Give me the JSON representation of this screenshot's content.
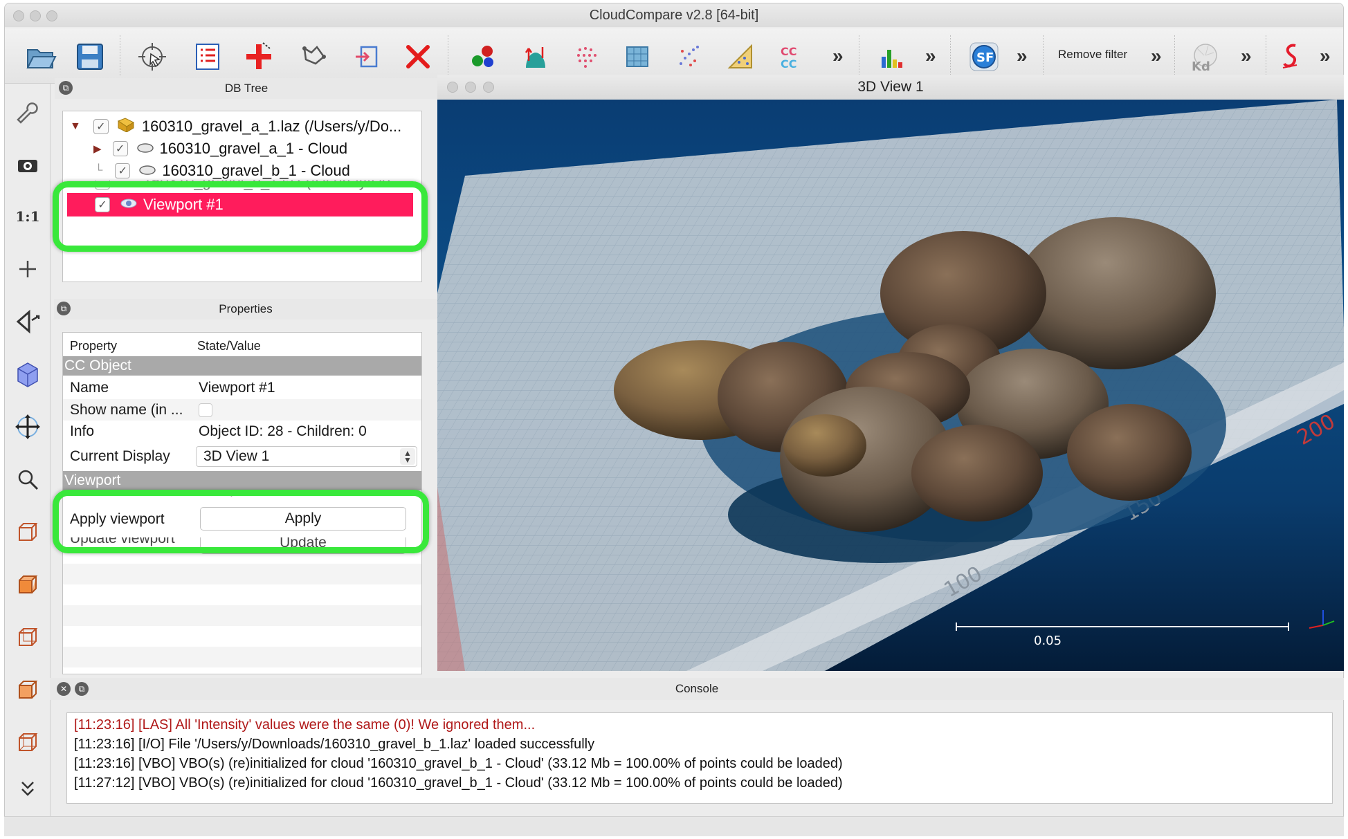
{
  "window": {
    "title": "CloudCompare v2.8 [64-bit]"
  },
  "toolbar": {
    "icons": [
      "open-folder-icon",
      "save-disk-icon",
      "cursor-select-icon",
      "list-icon",
      "add-point-icon",
      "segment-icon",
      "export-icon",
      "delete-x-icon",
      "color-icon",
      "normals-icon",
      "sample-icon",
      "mesh-icon",
      "noise-icon",
      "clean-icon",
      "cc-icon",
      "histogram-icon",
      "sf-icon",
      "kd-icon",
      "script-icon"
    ],
    "remove_filter_label": "Remove filter",
    "overflow_label": "»"
  },
  "left_tools": {
    "icons": [
      "wrench-icon",
      "camera-icon",
      "one-to-one-icon",
      "plus-icon",
      "perspective-icon",
      "cube-icon",
      "move-icon",
      "zoom-icon",
      "front-view-icon",
      "top-view-icon",
      "side-view-icon",
      "back-view-icon",
      "iso-view-icon",
      "expand-icon"
    ],
    "one_to_one_label": "1:1"
  },
  "db_tree": {
    "title": "DB Tree",
    "items": [
      {
        "label": "160310_gravel_a_1.laz (/Users/y/Do..."
      },
      {
        "label": "160310_gravel_a_1 - Cloud"
      },
      {
        "label": "160310_gravel_b_1 - Cloud"
      },
      {
        "label": "160310_gravel_b_1.laz (/Users/y/Do..."
      },
      {
        "label": "Viewport #1"
      }
    ]
  },
  "properties": {
    "title": "Properties",
    "col_property": "Property",
    "col_value": "State/Value",
    "section_cc_object": "CC Object",
    "rows": [
      {
        "name": "Name",
        "value": "Viewport #1"
      },
      {
        "name": "Show name (in ...",
        "value": ""
      },
      {
        "name": "Info",
        "value": "Object ID: 28 - Children: 0"
      },
      {
        "name": "Current Display",
        "value": "3D View 1"
      }
    ],
    "section_viewport": "Viewport",
    "viewport_name_label": "Name",
    "viewport_name_value": "Viewport #1",
    "apply_viewport_label": "Apply viewport",
    "apply_button": "Apply",
    "update_viewport_label": "Update viewport",
    "update_button": "Update"
  },
  "view3d": {
    "title": "3D View 1",
    "scale_label": "0.05",
    "ruler_labels": [
      "100",
      "150",
      "200"
    ]
  },
  "console": {
    "title": "Console",
    "lines": [
      {
        "text": "[11:23:16] [LAS] All 'Intensity' values were the same (0)! We ignored them...",
        "color": "#b01818"
      },
      {
        "text": "[11:23:16] [I/O] File '/Users/y/Downloads/160310_gravel_b_1.laz' loaded successfully",
        "color": "#111111"
      },
      {
        "text": "[11:23:16] [VBO] VBO(s) (re)initialized for cloud '160310_gravel_b_1 - Cloud' (33.12 Mb = 100.00% of points could be loaded)",
        "color": "#111111"
      },
      {
        "text": "[11:27:12] [VBO] VBO(s) (re)initialized for cloud '160310_gravel_b_1 - Cloud' (33.12 Mb = 100.00% of points could be loaded)",
        "color": "#111111"
      }
    ]
  },
  "colors": {
    "highlight": "#39e83b",
    "selection": "#ff1c5c",
    "viewport_bg": "#0c4d86"
  }
}
